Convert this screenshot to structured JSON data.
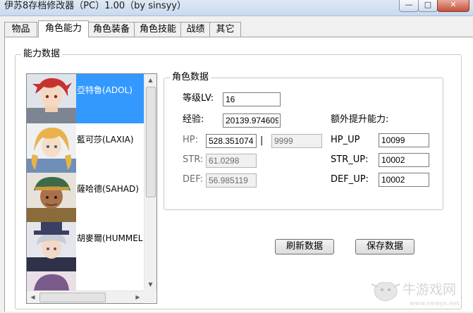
{
  "window": {
    "title": "伊苏8存档修改器（PC）1.00（by sinsyy）",
    "minimize_glyph": "—",
    "maximize_glyph": "□",
    "close_glyph": "✕"
  },
  "tabs": [
    {
      "label": "物品",
      "active": false
    },
    {
      "label": "角色能力",
      "active": true
    },
    {
      "label": "角色装备",
      "active": false
    },
    {
      "label": "角色技能",
      "active": false
    },
    {
      "label": "战绩",
      "active": false
    },
    {
      "label": "其它",
      "active": false
    }
  ],
  "ability_group": {
    "title": "能力数据"
  },
  "characters": [
    {
      "name": "亞特魯(ADOL)",
      "selected": true,
      "hair": "#c8322e",
      "portrait_icon": "adol-portrait-icon"
    },
    {
      "name": "藍可莎(LAXIA)",
      "selected": false,
      "hair": "#e8b34a",
      "portrait_icon": "laxia-portrait-icon"
    },
    {
      "name": "薩哈德(SAHAD)",
      "selected": false,
      "hair": "#3d6b4a",
      "portrait_icon": "sahad-portrait-icon"
    },
    {
      "name": "胡麥爾(HUMMEL",
      "selected": false,
      "hair": "#3a3f63",
      "portrait_icon": "hummel-portrait-icon"
    }
  ],
  "char_data": {
    "title": "角色数据",
    "level_label": "等级LV:",
    "level_value": "16",
    "exp_label": "经验:",
    "exp_value": "20139.974609",
    "hp_label": "HP:",
    "hp_value": "528.351074",
    "hp_separator": "|",
    "hp_max": "9999",
    "str_label": "STR:",
    "str_value": "61.0298",
    "def_label": "DEF:",
    "def_value": "56.985119",
    "extra_label": "额外提升能力:",
    "hp_up_label": "HP_UP",
    "hp_up_value": "10099",
    "str_up_label": "STR_UP:",
    "str_up_value": "10002",
    "def_up_label": "DEF_UP:",
    "def_up_value": "10002"
  },
  "buttons": {
    "refresh": "刷新数据",
    "save": "保存数据"
  },
  "watermark": {
    "text": "牛游戏网",
    "url": "www.newyx.net"
  },
  "colors": {
    "selection": "#3399ff",
    "watermark": "#d9d9d9"
  }
}
